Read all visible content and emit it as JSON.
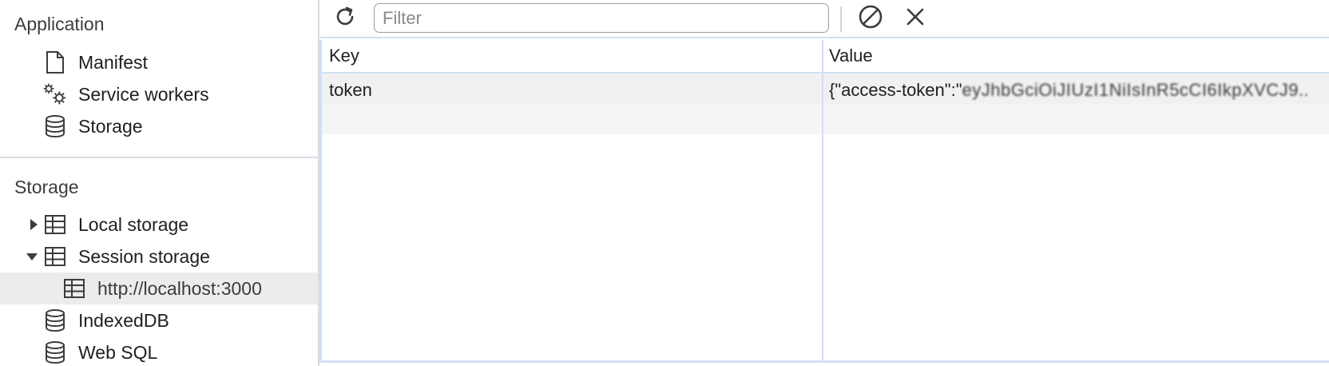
{
  "sidebar": {
    "application_title": "Application",
    "application_items": [
      {
        "label": "Manifest",
        "icon": "document-icon"
      },
      {
        "label": "Service workers",
        "icon": "gears-icon"
      },
      {
        "label": "Storage",
        "icon": "database-icon"
      }
    ],
    "storage_title": "Storage",
    "storage_items": [
      {
        "label": "Local storage",
        "icon": "table-icon",
        "expanded": false
      },
      {
        "label": "Session storage",
        "icon": "table-icon",
        "expanded": true
      },
      {
        "label": "http://localhost:3000",
        "icon": "table-icon",
        "selected": true
      },
      {
        "label": "IndexedDB",
        "icon": "database-icon"
      },
      {
        "label": "Web SQL",
        "icon": "database-icon"
      }
    ]
  },
  "toolbar": {
    "refresh_icon": "refresh-icon",
    "filter_placeholder": "Filter",
    "filter_value": "",
    "clear_all_icon": "block-icon",
    "delete_icon": "close-icon"
  },
  "grid": {
    "columns": [
      "Key",
      "Value"
    ],
    "rows": [
      {
        "key": "token",
        "value_prefix": "{\"access-token\":\"",
        "value_obscured": "eyJhbGciOiJIUzI1NiIsInR5cCI6IkpXVCJ9..."
      }
    ]
  },
  "colors": {
    "selected_bg": "#ececec",
    "grid_border": "#d0dff6",
    "row_bg": "#f1f1f1"
  }
}
